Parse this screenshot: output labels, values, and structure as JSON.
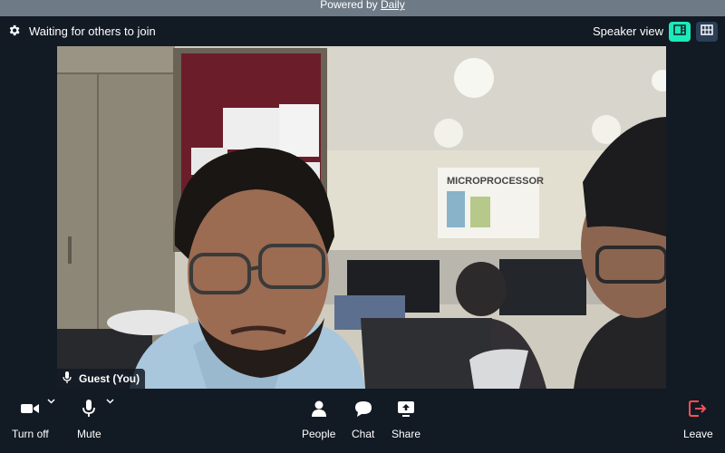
{
  "banner": {
    "prefix": "Powered by",
    "link": "Daily"
  },
  "header": {
    "status_text": "Waiting for others to join",
    "view_label": "Speaker view"
  },
  "participant": {
    "name": "Guest (You)"
  },
  "video_poster": {
    "text": "MICROPROCESSOR"
  },
  "tray": {
    "camera_label": "Turn off",
    "mic_label": "Mute",
    "people_label": "People",
    "chat_label": "Chat",
    "share_label": "Share",
    "leave_label": "Leave"
  },
  "colors": {
    "background": "#121a24",
    "banner": "#6f7a87",
    "accent": "#1bebb9",
    "leave": "#ff4f55"
  }
}
